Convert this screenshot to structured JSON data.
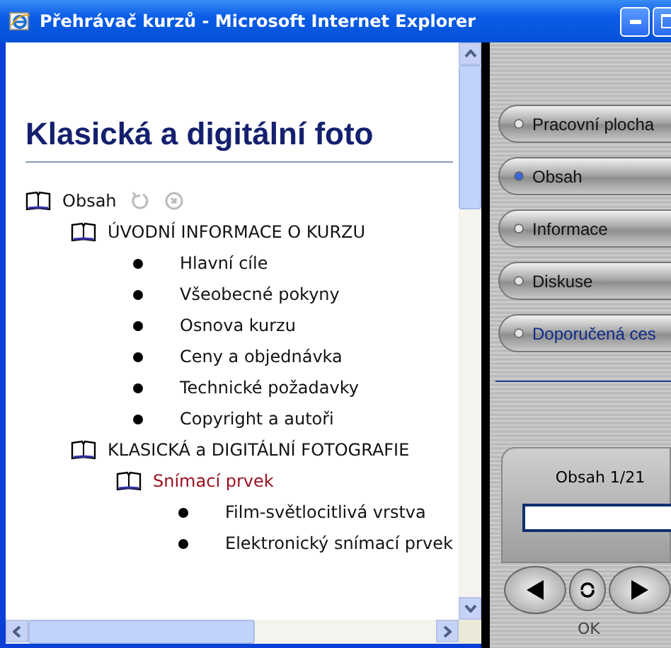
{
  "window": {
    "title": "Přehrávač kurzů - Microsoft Internet Explorer"
  },
  "content": {
    "heading": "Klasická a digitální foto",
    "tree": [
      {
        "label": "Obsah",
        "kind": "book",
        "selected": false,
        "children": [
          {
            "label": "ÚVODNÍ INFORMACE O KURZU",
            "kind": "book",
            "selected": false,
            "children": [
              {
                "label": "Hlavní cíle",
                "kind": "page",
                "selected": false
              },
              {
                "label": "Všeobecné pokyny",
                "kind": "page",
                "selected": false
              },
              {
                "label": "Osnova kurzu",
                "kind": "page",
                "selected": false
              },
              {
                "label": "Ceny a objednávka",
                "kind": "page",
                "selected": false
              },
              {
                "label": "Technické požadavky",
                "kind": "page",
                "selected": false
              },
              {
                "label": "Copyright a autoři",
                "kind": "page",
                "selected": false
              }
            ]
          },
          {
            "label": "KLASICKÁ a DIGITÁLNÍ FOTOGRAFIE",
            "kind": "book",
            "selected": false,
            "children": [
              {
                "label": "Snímací prvek",
                "kind": "book",
                "selected": true,
                "children": [
                  {
                    "label": "Film-světlocitlivá vrstva",
                    "kind": "page",
                    "selected": false
                  },
                  {
                    "label": "Elektronický snímací prvek",
                    "kind": "page",
                    "selected": false
                  }
                ]
              }
            ]
          }
        ]
      }
    ]
  },
  "navigation": [
    {
      "label": "Pracovní plocha",
      "selected": false,
      "kind": "normal"
    },
    {
      "label": "Obsah",
      "selected": true,
      "kind": "normal"
    },
    {
      "label": "Informace",
      "selected": false,
      "kind": "normal"
    },
    {
      "label": "Diskuse",
      "selected": false,
      "kind": "normal"
    },
    {
      "label": "Doporučená ces",
      "selected": false,
      "kind": "link"
    }
  ],
  "player": {
    "position": "Obsah 1/21",
    "status": "OK"
  }
}
